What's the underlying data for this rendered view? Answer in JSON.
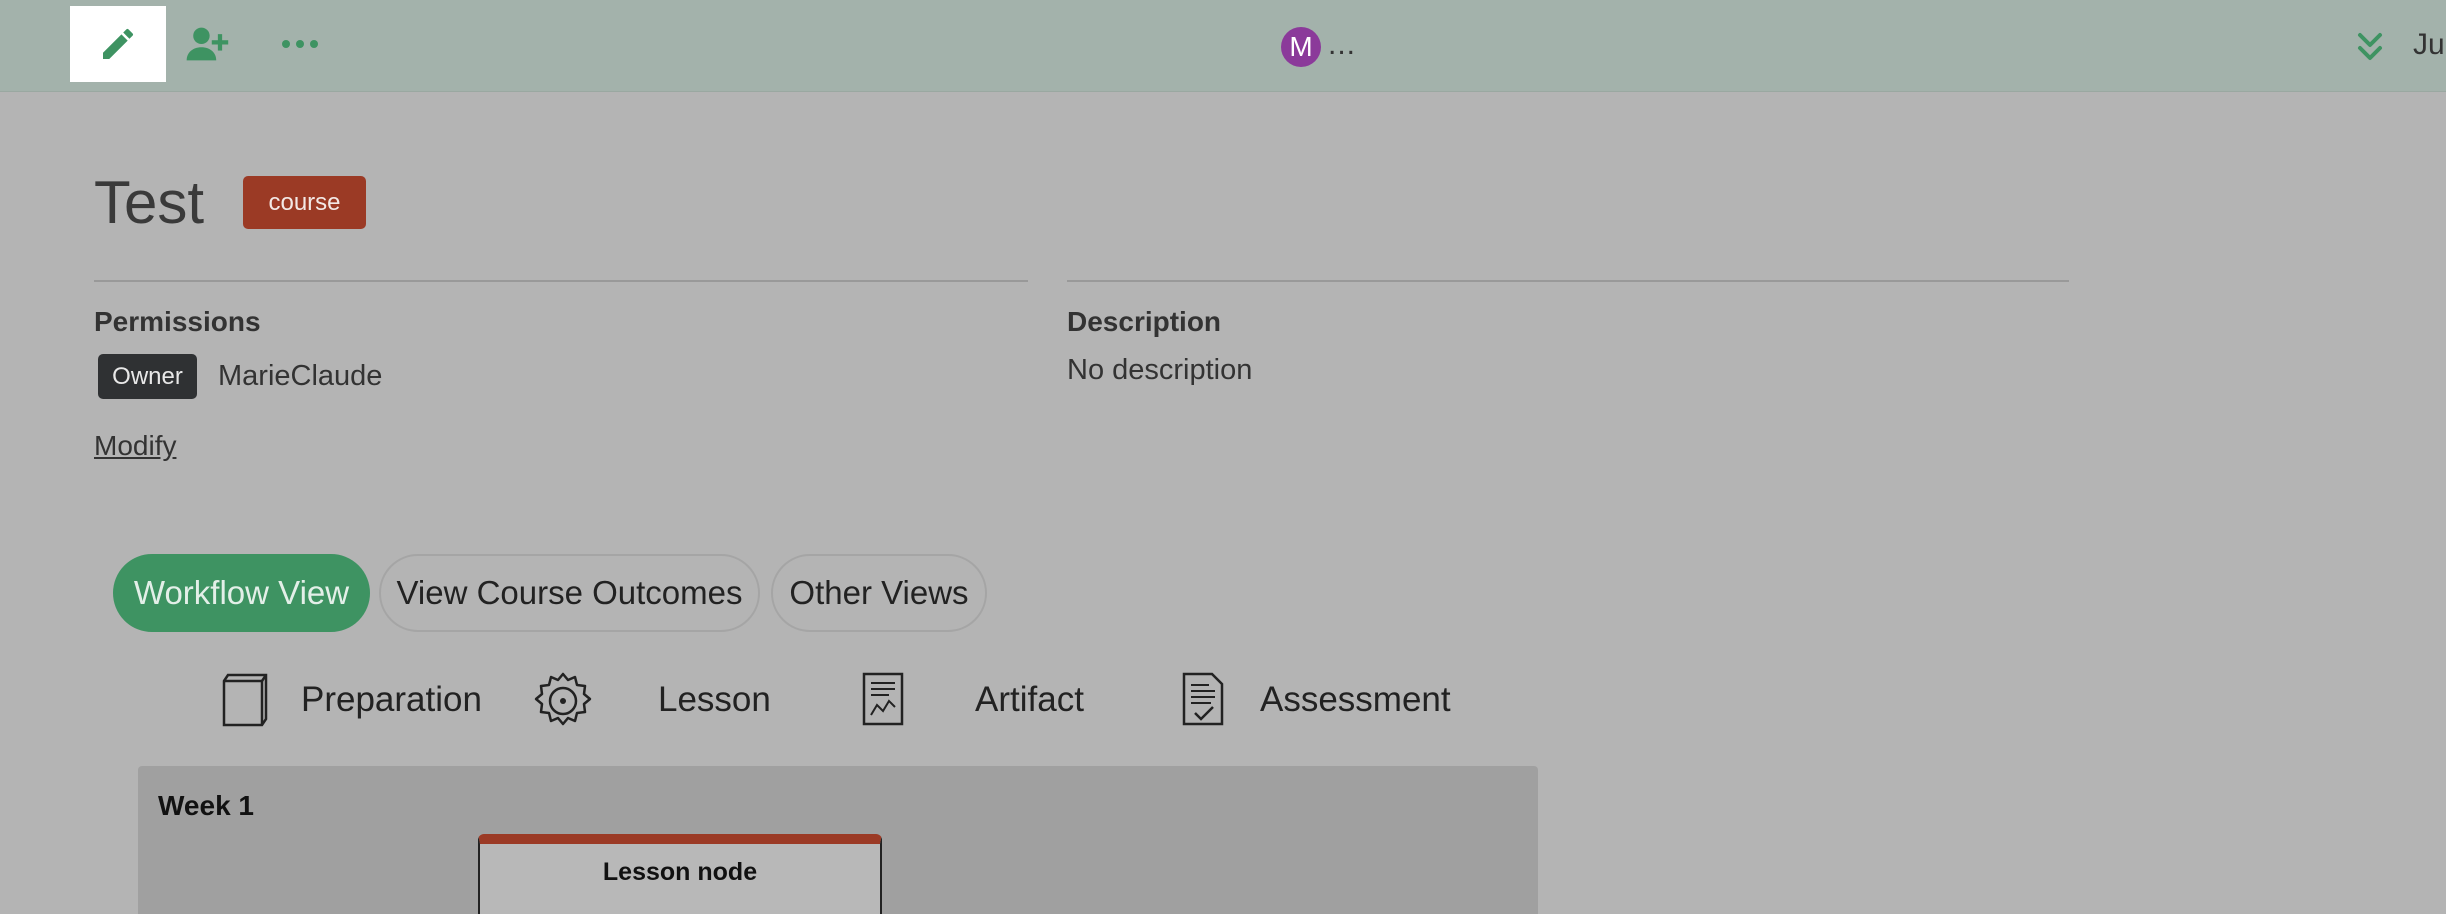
{
  "toolbar": {
    "edit_icon": "pencil-icon",
    "share_icon": "user-plus-icon",
    "more_icon": "ellipsis-icon",
    "accent_color": "#3e9362"
  },
  "users": {
    "avatar_letter": "M",
    "more": "...",
    "avatar_color": "#8b3a9a"
  },
  "topbar_right": {
    "expand_icon": "chevrons-down-icon",
    "label": "Ju"
  },
  "project": {
    "title": "Test",
    "type": "course",
    "type_color": "#9b3a25"
  },
  "permissions": {
    "heading": "Permissions",
    "role": "Owner",
    "user": "MarieClaude",
    "modify": "Modify"
  },
  "description": {
    "heading": "Description",
    "text": "No description"
  },
  "tabs": [
    {
      "label": "Workflow View",
      "active": true
    },
    {
      "label": "View Course Outcomes",
      "active": false
    },
    {
      "label": "Other Views",
      "active": false
    }
  ],
  "legend": [
    {
      "icon": "book-icon",
      "label": "Preparation"
    },
    {
      "icon": "gear-icon",
      "label": "Lesson"
    },
    {
      "icon": "document-chart-icon",
      "label": "Artifact"
    },
    {
      "icon": "document-check-icon",
      "label": "Assessment"
    }
  ],
  "week": {
    "title": "Week 1",
    "node_title": "Lesson node"
  }
}
